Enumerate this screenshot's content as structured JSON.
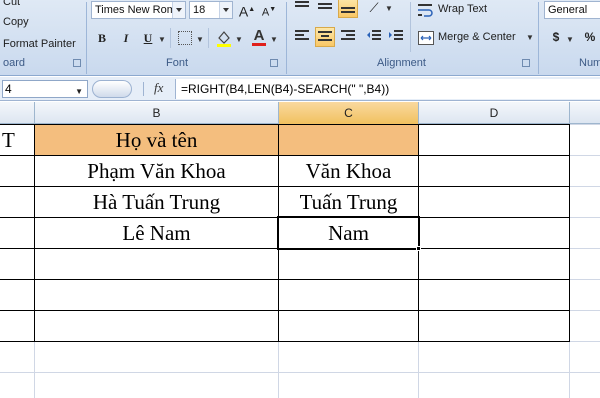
{
  "clipboard": {
    "cut_label": "Cut",
    "copy_label": "Copy",
    "format_painter_label": "Format Painter",
    "group_label": "oard"
  },
  "font": {
    "name": "Times New Rom",
    "size": "18",
    "grow_glyph": "A",
    "shrink_glyph": "A",
    "bold": "B",
    "italic": "I",
    "underline": "U",
    "font_color_glyph": "A",
    "group_label": "Font"
  },
  "alignment": {
    "wrap_text_label": "Wrap Text",
    "merge_label": "Merge & Center",
    "group_label": "Alignment"
  },
  "number": {
    "format": "General",
    "currency": "$",
    "percent": "%",
    "group_label": "Num"
  },
  "formula_bar": {
    "name_box": "4",
    "fx": "fx",
    "formula": "=RIGHT(B4,LEN(B4)-SEARCH(\" \",B4))"
  },
  "columns": [
    "B",
    "C",
    "D"
  ],
  "rows": [
    {
      "a": "T",
      "b": "Họ và tên",
      "c": ""
    },
    {
      "a": "",
      "b": "Phạm Văn Khoa",
      "c": "Văn Khoa"
    },
    {
      "a": "",
      "b": "Hà Tuấn Trung",
      "c": "Tuấn Trung"
    },
    {
      "a": "",
      "b": "Lê Nam",
      "c": "Nam"
    }
  ],
  "colors": {
    "header_fill": "#f4be7e",
    "grid_line": "#000000",
    "ribbon": "#dfe9f5"
  }
}
